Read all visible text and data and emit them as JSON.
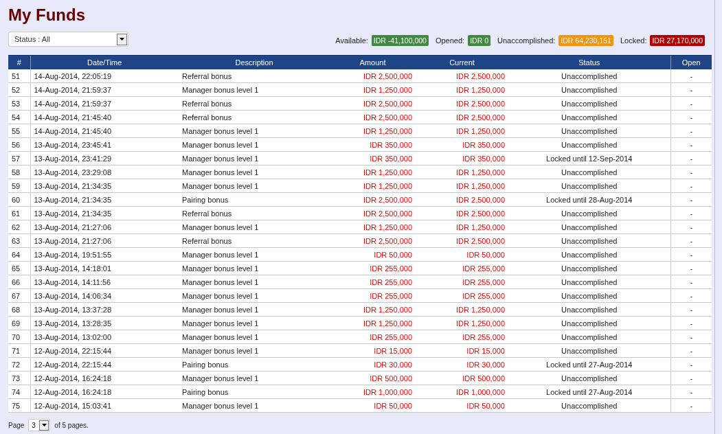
{
  "title": "My Funds",
  "status_filter": {
    "value": "Status : All"
  },
  "balances": [
    {
      "label": "Available:",
      "value": "IDR -41,100,000",
      "color": "#3f8a3f"
    },
    {
      "label": "Opened:",
      "value": "IDR 0",
      "color": "#3f8a3f"
    },
    {
      "label": "Unaccomplished:",
      "value": "IDR 64,230,151",
      "color": "#f5930a"
    },
    {
      "label": "Locked:",
      "value": "IDR 27,170,000",
      "color": "#b30000"
    }
  ],
  "table": {
    "columns": [
      "#",
      "Date/Time",
      "Description",
      "Amount",
      "Current",
      "Status",
      "Open"
    ],
    "rows": [
      {
        "no": "51",
        "date": "14-Aug-2014, 22:05:19",
        "description": "Referral bonus",
        "amount": "IDR 2,500,000",
        "current": "IDR 2,500,000",
        "status": "Unaccomplished",
        "open": "-"
      },
      {
        "no": "52",
        "date": "14-Aug-2014, 21:59:37",
        "description": "Manager bonus level 1",
        "amount": "IDR 1,250,000",
        "current": "IDR 1,250,000",
        "status": "Unaccomplished",
        "open": "-"
      },
      {
        "no": "53",
        "date": "14-Aug-2014, 21:59:37",
        "description": "Referral bonus",
        "amount": "IDR 2,500,000",
        "current": "IDR 2,500,000",
        "status": "Unaccomplished",
        "open": "-"
      },
      {
        "no": "54",
        "date": "14-Aug-2014, 21:45:40",
        "description": "Referral bonus",
        "amount": "IDR 2,500,000",
        "current": "IDR 2,500,000",
        "status": "Unaccomplished",
        "open": "-"
      },
      {
        "no": "55",
        "date": "14-Aug-2014, 21:45:40",
        "description": "Manager bonus level 1",
        "amount": "IDR 1,250,000",
        "current": "IDR 1,250,000",
        "status": "Unaccomplished",
        "open": "-"
      },
      {
        "no": "56",
        "date": "13-Aug-2014, 23:45:41",
        "description": "Manager bonus level 1",
        "amount": "IDR 350,000",
        "current": "IDR 350,000",
        "status": "Unaccomplished",
        "open": "-"
      },
      {
        "no": "57",
        "date": "13-Aug-2014, 23:41:29",
        "description": "Manager bonus level 1",
        "amount": "IDR 350,000",
        "current": "IDR 350,000",
        "status": "Locked until 12-Sep-2014",
        "open": "-"
      },
      {
        "no": "58",
        "date": "13-Aug-2014, 23:29:08",
        "description": "Manager bonus level 1",
        "amount": "IDR 1,250,000",
        "current": "IDR 1,250,000",
        "status": "Unaccomplished",
        "open": "-"
      },
      {
        "no": "59",
        "date": "13-Aug-2014, 21:34:35",
        "description": "Manager bonus level 1",
        "amount": "IDR 1,250,000",
        "current": "IDR 1,250,000",
        "status": "Unaccomplished",
        "open": "-"
      },
      {
        "no": "60",
        "date": "13-Aug-2014, 21:34:35",
        "description": "Pairing bonus",
        "amount": "IDR 2,500,000",
        "current": "IDR 2,500,000",
        "status": "Locked until 28-Aug-2014",
        "open": "-"
      },
      {
        "no": "61",
        "date": "13-Aug-2014, 21:34:35",
        "description": "Referral bonus",
        "amount": "IDR 2,500,000",
        "current": "IDR 2,500,000",
        "status": "Unaccomplished",
        "open": "-"
      },
      {
        "no": "62",
        "date": "13-Aug-2014, 21:27:06",
        "description": "Manager bonus level 1",
        "amount": "IDR 1,250,000",
        "current": "IDR 1,250,000",
        "status": "Unaccomplished",
        "open": "-"
      },
      {
        "no": "63",
        "date": "13-Aug-2014, 21:27:06",
        "description": "Referral bonus",
        "amount": "IDR 2,500,000",
        "current": "IDR 2,500,000",
        "status": "Unaccomplished",
        "open": "-"
      },
      {
        "no": "64",
        "date": "13-Aug-2014, 19:51:55",
        "description": "Manager bonus level 1",
        "amount": "IDR 50,000",
        "current": "IDR 50,000",
        "status": "Unaccomplished",
        "open": "-"
      },
      {
        "no": "65",
        "date": "13-Aug-2014, 14:18:01",
        "description": "Manager bonus level 1",
        "amount": "IDR 255,000",
        "current": "IDR 255,000",
        "status": "Unaccomplished",
        "open": "-"
      },
      {
        "no": "66",
        "date": "13-Aug-2014, 14:11:56",
        "description": "Manager bonus level 1",
        "amount": "IDR 255,000",
        "current": "IDR 255,000",
        "status": "Unaccomplished",
        "open": "-"
      },
      {
        "no": "67",
        "date": "13-Aug-2014, 14:06:34",
        "description": "Manager bonus level 1",
        "amount": "IDR 255,000",
        "current": "IDR 255,000",
        "status": "Unaccomplished",
        "open": "-"
      },
      {
        "no": "68",
        "date": "13-Aug-2014, 13:37:28",
        "description": "Manager bonus level 1",
        "amount": "IDR 1,250,000",
        "current": "IDR 1,250,000",
        "status": "Unaccomplished",
        "open": "-"
      },
      {
        "no": "69",
        "date": "13-Aug-2014, 13:28:35",
        "description": "Manager bonus level 1",
        "amount": "IDR 1,250,000",
        "current": "IDR 1,250,000",
        "status": "Unaccomplished",
        "open": "-"
      },
      {
        "no": "70",
        "date": "13-Aug-2014, 13:02:00",
        "description": "Manager bonus level 1",
        "amount": "IDR 255,000",
        "current": "IDR 255,000",
        "status": "Unaccomplished",
        "open": "-"
      },
      {
        "no": "71",
        "date": "12-Aug-2014, 22:15:44",
        "description": "Manager bonus level 1",
        "amount": "IDR 15,000",
        "current": "IDR 15,000",
        "status": "Unaccomplished",
        "open": "-"
      },
      {
        "no": "72",
        "date": "12-Aug-2014, 22:15:44",
        "description": "Pairing bonus",
        "amount": "IDR 30,000",
        "current": "IDR 30,000",
        "status": "Locked until 27-Aug-2014",
        "open": "-"
      },
      {
        "no": "73",
        "date": "12-Aug-2014, 16:24:18",
        "description": "Manager bonus level 1",
        "amount": "IDR 500,000",
        "current": "IDR 500,000",
        "status": "Unaccomplished",
        "open": "-"
      },
      {
        "no": "74",
        "date": "12-Aug-2014, 16:24:18",
        "description": "Pairing bonus",
        "amount": "IDR 1,000,000",
        "current": "IDR 1,000,000",
        "status": "Locked until 27-Aug-2014",
        "open": "-"
      },
      {
        "no": "75",
        "date": "12-Aug-2014, 15:03:41",
        "description": "Manager bonus level 1",
        "amount": "IDR 50,000",
        "current": "IDR 50,000",
        "status": "Unaccomplished",
        "open": "-"
      }
    ]
  },
  "pagination": {
    "label": "Page",
    "page": "3",
    "suffix": "of 5 pages."
  }
}
